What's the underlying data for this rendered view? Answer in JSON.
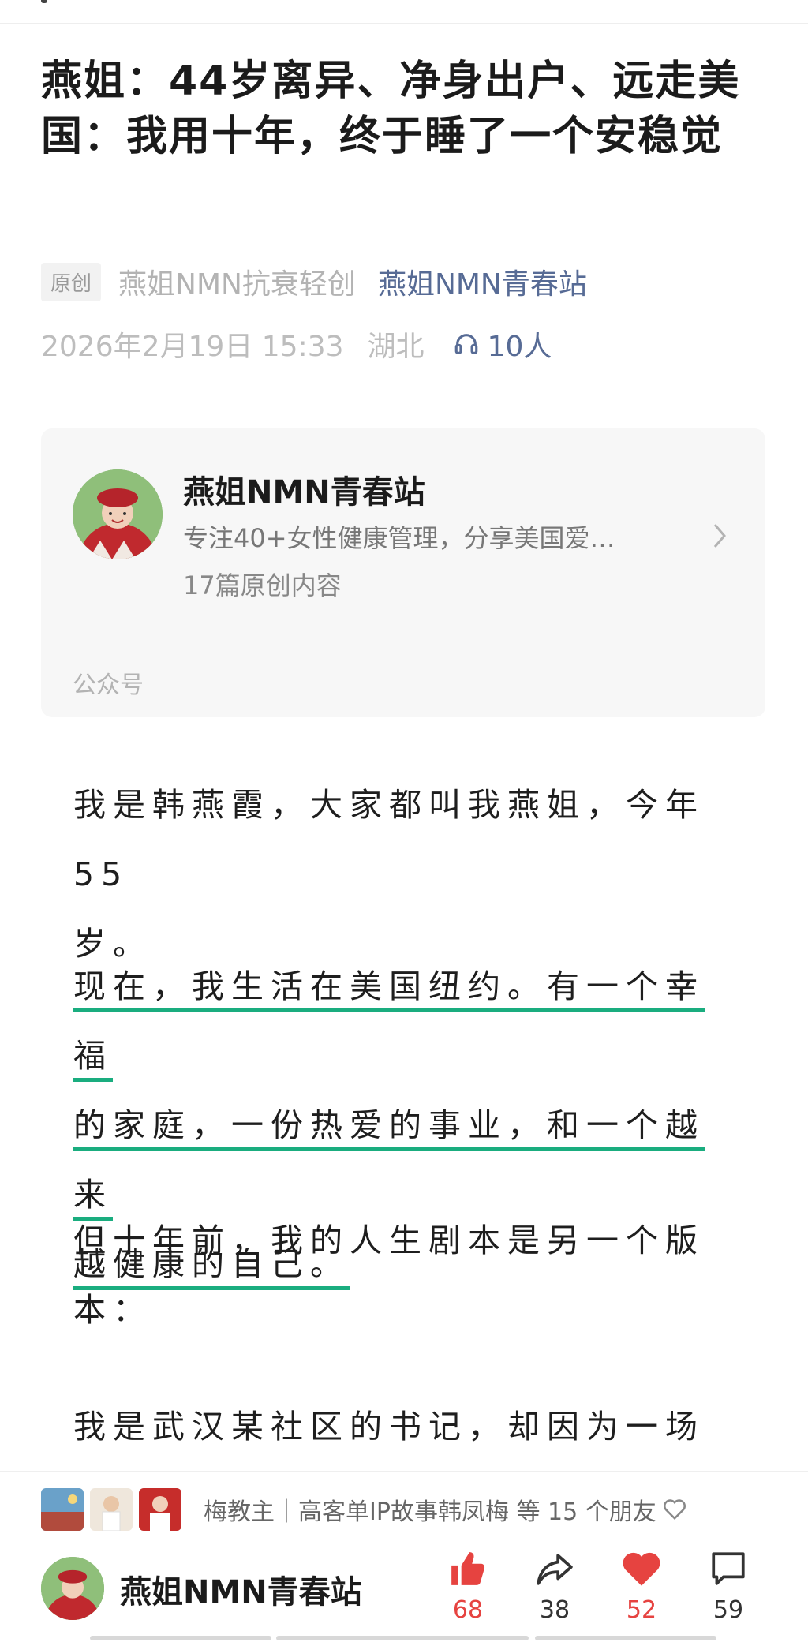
{
  "article": {
    "title": "燕姐：44岁离异、净身出户、远走美国：我用十年，终于睡了一个安稳觉",
    "badge": "原创",
    "author": "燕姐NMN抗衰轻创",
    "account_name": "燕姐NMN青春站",
    "date": "2026年2月19日 15:33",
    "location": "湖北",
    "listeners": "10人"
  },
  "account_card": {
    "name": "燕姐NMN青春站",
    "description": "专注40+女性健康管理，分享美国爱…",
    "article_count": "17篇原创内容",
    "footer": "公众号"
  },
  "body": {
    "p1": [
      "我是韩燕霞，大家都叫我燕姐，今年55",
      "岁。"
    ],
    "p2": [
      "现在，我生活在美国纽约。有一个幸福",
      "的家庭，一份热爱的事业，和一个越来",
      "越健康的自己。"
    ],
    "p3": [
      "但十年前，我的人生剧本是另一个版",
      "本："
    ],
    "p4": [
      "我是武汉某社区的书记，却因为一场病"
    ]
  },
  "bottom_bar": {
    "friends_text": "梅教主｜高客单IP故事韩凤梅 等 15 个朋友",
    "account_name": "燕姐NMN青春站",
    "like_count": "68",
    "share_count": "38",
    "love_count": "52",
    "comment_count": "59"
  },
  "colors": {
    "link": "#576b95",
    "highlight_underline": "#1aad7f",
    "like_red": "#e64340"
  },
  "icons": [
    "headphones-icon",
    "chevron-right-icon",
    "heart-outline-icon",
    "thumbs-up-icon",
    "share-icon",
    "heart-icon",
    "comment-icon"
  ]
}
